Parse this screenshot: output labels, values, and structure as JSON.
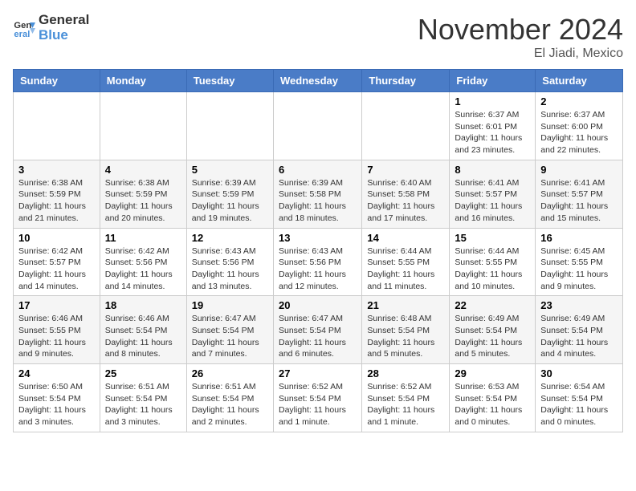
{
  "header": {
    "logo_line1": "General",
    "logo_line2": "Blue",
    "month": "November 2024",
    "location": "El Jiadi, Mexico"
  },
  "weekdays": [
    "Sunday",
    "Monday",
    "Tuesday",
    "Wednesday",
    "Thursday",
    "Friday",
    "Saturday"
  ],
  "weeks": [
    [
      {
        "day": "",
        "info": ""
      },
      {
        "day": "",
        "info": ""
      },
      {
        "day": "",
        "info": ""
      },
      {
        "day": "",
        "info": ""
      },
      {
        "day": "",
        "info": ""
      },
      {
        "day": "1",
        "info": "Sunrise: 6:37 AM\nSunset: 6:01 PM\nDaylight: 11 hours and 23 minutes."
      },
      {
        "day": "2",
        "info": "Sunrise: 6:37 AM\nSunset: 6:00 PM\nDaylight: 11 hours and 22 minutes."
      }
    ],
    [
      {
        "day": "3",
        "info": "Sunrise: 6:38 AM\nSunset: 5:59 PM\nDaylight: 11 hours and 21 minutes."
      },
      {
        "day": "4",
        "info": "Sunrise: 6:38 AM\nSunset: 5:59 PM\nDaylight: 11 hours and 20 minutes."
      },
      {
        "day": "5",
        "info": "Sunrise: 6:39 AM\nSunset: 5:59 PM\nDaylight: 11 hours and 19 minutes."
      },
      {
        "day": "6",
        "info": "Sunrise: 6:39 AM\nSunset: 5:58 PM\nDaylight: 11 hours and 18 minutes."
      },
      {
        "day": "7",
        "info": "Sunrise: 6:40 AM\nSunset: 5:58 PM\nDaylight: 11 hours and 17 minutes."
      },
      {
        "day": "8",
        "info": "Sunrise: 6:41 AM\nSunset: 5:57 PM\nDaylight: 11 hours and 16 minutes."
      },
      {
        "day": "9",
        "info": "Sunrise: 6:41 AM\nSunset: 5:57 PM\nDaylight: 11 hours and 15 minutes."
      }
    ],
    [
      {
        "day": "10",
        "info": "Sunrise: 6:42 AM\nSunset: 5:57 PM\nDaylight: 11 hours and 14 minutes."
      },
      {
        "day": "11",
        "info": "Sunrise: 6:42 AM\nSunset: 5:56 PM\nDaylight: 11 hours and 14 minutes."
      },
      {
        "day": "12",
        "info": "Sunrise: 6:43 AM\nSunset: 5:56 PM\nDaylight: 11 hours and 13 minutes."
      },
      {
        "day": "13",
        "info": "Sunrise: 6:43 AM\nSunset: 5:56 PM\nDaylight: 11 hours and 12 minutes."
      },
      {
        "day": "14",
        "info": "Sunrise: 6:44 AM\nSunset: 5:55 PM\nDaylight: 11 hours and 11 minutes."
      },
      {
        "day": "15",
        "info": "Sunrise: 6:44 AM\nSunset: 5:55 PM\nDaylight: 11 hours and 10 minutes."
      },
      {
        "day": "16",
        "info": "Sunrise: 6:45 AM\nSunset: 5:55 PM\nDaylight: 11 hours and 9 minutes."
      }
    ],
    [
      {
        "day": "17",
        "info": "Sunrise: 6:46 AM\nSunset: 5:55 PM\nDaylight: 11 hours and 9 minutes."
      },
      {
        "day": "18",
        "info": "Sunrise: 6:46 AM\nSunset: 5:54 PM\nDaylight: 11 hours and 8 minutes."
      },
      {
        "day": "19",
        "info": "Sunrise: 6:47 AM\nSunset: 5:54 PM\nDaylight: 11 hours and 7 minutes."
      },
      {
        "day": "20",
        "info": "Sunrise: 6:47 AM\nSunset: 5:54 PM\nDaylight: 11 hours and 6 minutes."
      },
      {
        "day": "21",
        "info": "Sunrise: 6:48 AM\nSunset: 5:54 PM\nDaylight: 11 hours and 5 minutes."
      },
      {
        "day": "22",
        "info": "Sunrise: 6:49 AM\nSunset: 5:54 PM\nDaylight: 11 hours and 5 minutes."
      },
      {
        "day": "23",
        "info": "Sunrise: 6:49 AM\nSunset: 5:54 PM\nDaylight: 11 hours and 4 minutes."
      }
    ],
    [
      {
        "day": "24",
        "info": "Sunrise: 6:50 AM\nSunset: 5:54 PM\nDaylight: 11 hours and 3 minutes."
      },
      {
        "day": "25",
        "info": "Sunrise: 6:51 AM\nSunset: 5:54 PM\nDaylight: 11 hours and 3 minutes."
      },
      {
        "day": "26",
        "info": "Sunrise: 6:51 AM\nSunset: 5:54 PM\nDaylight: 11 hours and 2 minutes."
      },
      {
        "day": "27",
        "info": "Sunrise: 6:52 AM\nSunset: 5:54 PM\nDaylight: 11 hours and 1 minute."
      },
      {
        "day": "28",
        "info": "Sunrise: 6:52 AM\nSunset: 5:54 PM\nDaylight: 11 hours and 1 minute."
      },
      {
        "day": "29",
        "info": "Sunrise: 6:53 AM\nSunset: 5:54 PM\nDaylight: 11 hours and 0 minutes."
      },
      {
        "day": "30",
        "info": "Sunrise: 6:54 AM\nSunset: 5:54 PM\nDaylight: 11 hours and 0 minutes."
      }
    ]
  ]
}
